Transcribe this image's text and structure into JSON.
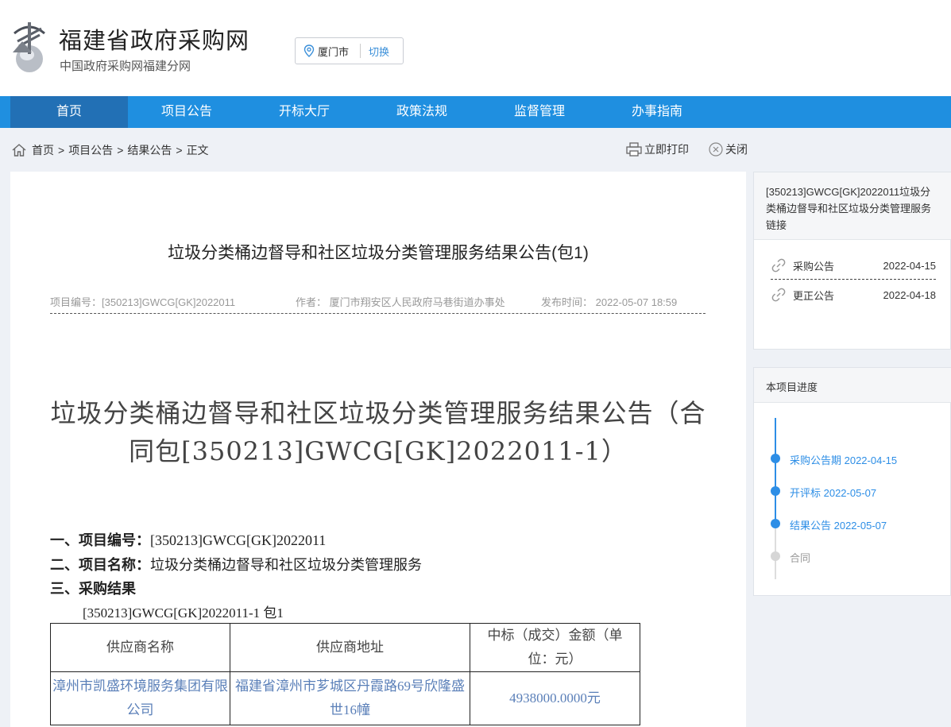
{
  "header": {
    "site_title": "福建省政府采购网",
    "site_subtitle": "中国政府采购网福建分网",
    "city": "厦门市",
    "city_switch": "切换"
  },
  "nav": {
    "items": [
      "首页",
      "项目公告",
      "开标大厅",
      "政策法规",
      "监督管理",
      "办事指南"
    ],
    "active": "首页"
  },
  "breadcrumb": {
    "items": [
      "首页",
      "项目公告",
      "结果公告",
      "正文"
    ],
    "separator": ">"
  },
  "tools": {
    "print": "立即打印",
    "close": "关闭"
  },
  "article": {
    "title": "垃圾分类桶边督导和社区垃圾分类管理服务结果公告(包1)",
    "meta": {
      "project_no": "项目编号：[350213]GWCG[GK]2022011",
      "author": "作者：  厦门市翔安区人民政府马巷街道办事处",
      "publish_time": "发布时间：  2022-05-07 18:59"
    },
    "doc_title": "垃圾分类桶边督导和社区垃圾分类管理服务结果公告（合同包[350213]GWCG[GK]2022011-1）",
    "sections": {
      "s1_label": "一、项目编号：",
      "s1_value": "[350213]GWCG[GK]2022011",
      "s2_label": "二、项目名称：",
      "s2_value": "垃圾分类桶边督导和社区垃圾分类管理服务",
      "s3_label": "三、采购结果",
      "package": "[350213]GWCG[GK]2022011-1 包1"
    },
    "table": {
      "headers": [
        "供应商名称",
        "供应商地址",
        "中标（成交）金额（单位：元）"
      ],
      "rows": [
        [
          "漳州市凯盛环境服务集团有限公司",
          "福建省漳州市芗城区丹霞路69号欣隆盛世16幢",
          "4938000.0000元"
        ]
      ]
    }
  },
  "sidebar": {
    "links_panel": {
      "title": "[350213]GWCG[GK]2022011垃圾分类桶边督导和社区垃圾分类管理服务链接",
      "links": [
        {
          "label": "采购公告",
          "date": "2022-04-15"
        },
        {
          "label": "更正公告",
          "date": "2022-04-18"
        }
      ]
    },
    "progress_panel": {
      "title": "本项目进度",
      "steps": [
        {
          "label": "采购公告期 2022-04-15",
          "done": true
        },
        {
          "label": "开评标 2022-05-07",
          "done": true
        },
        {
          "label": "结果公告 2022-05-07",
          "done": true
        },
        {
          "label": "合同",
          "done": false
        }
      ]
    }
  },
  "colors": {
    "nav_bg": "#1f8fe0",
    "nav_active": "#2270b5",
    "accent": "#2d8ee6"
  }
}
